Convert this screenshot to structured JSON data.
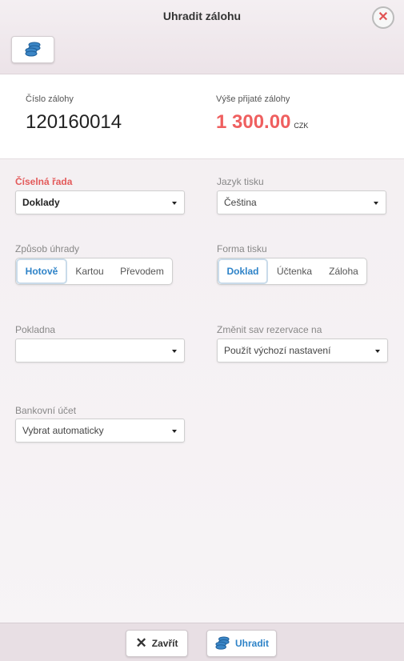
{
  "dialog": {
    "title": "Uhradit zálohu"
  },
  "icons": {
    "close": "close-icon",
    "coins": "coins-icon"
  },
  "colors": {
    "accent": "#2e83c8",
    "danger": "#e35a5a",
    "amount": "#ef5f5f"
  },
  "info": {
    "number_label": "Číslo zálohy",
    "number_value": "120160014",
    "amount_label": "Výše přijaté zálohy",
    "amount_value": "1 300.00",
    "currency": "CZK"
  },
  "form": {
    "series_label": "Číselná řada",
    "series_value": "Doklady",
    "language_label": "Jazyk tisku",
    "language_value": "Čeština",
    "payment_label": "Způsob úhrady",
    "payment_options": [
      "Hotově",
      "Kartou",
      "Převodem"
    ],
    "print_form_label": "Forma tisku",
    "print_form_options": [
      "Doklad",
      "Účtenka",
      "Záloha"
    ],
    "cashdesk_label": "Pokladna",
    "cashdesk_value": "",
    "reservation_label": "Změnit sav rezervace na",
    "reservation_value": "Použít výchozí nastavení",
    "bank_label": "Bankovní účet",
    "bank_value": "Vybrat automaticky"
  },
  "footer": {
    "close_label": "Zavřít",
    "pay_label": "Uhradit"
  }
}
